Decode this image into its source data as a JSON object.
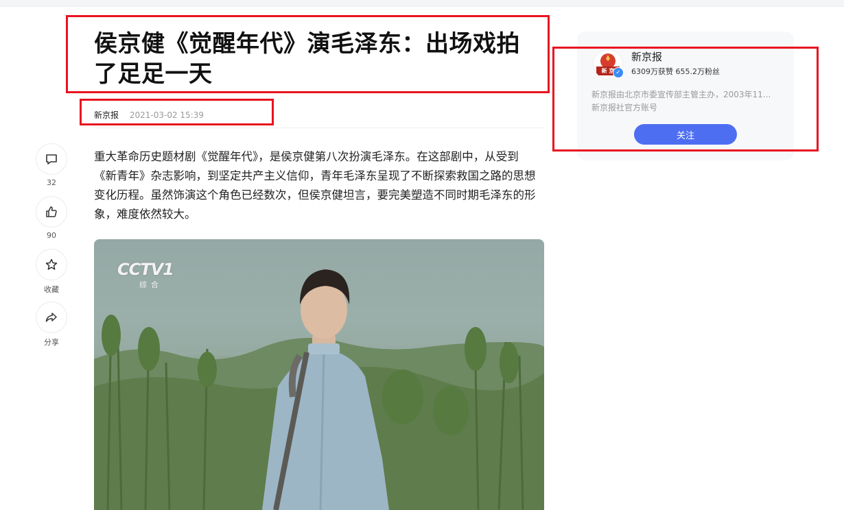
{
  "article": {
    "title": "侯京健《觉醒年代》演毛泽东：出场戏拍了足足一天",
    "source": "新京报",
    "date": "2021-03-02 15:39",
    "body": "重大革命历史题材剧《觉醒年代》，是侯京健第八次扮演毛泽东。在这部剧中，从受到《新青年》杂志影响，到坚定共产主义信仰，青年毛泽东呈现了不断探索救国之路的思想变化历程。虽然饰演这个角色已经数次，但侯京健坦言，要完美塑造不同时期毛泽东的形象，难度依然较大。"
  },
  "actions": [
    {
      "icon": "comment-icon",
      "label": "32"
    },
    {
      "icon": "thumbs-up-icon",
      "label": "90"
    },
    {
      "icon": "star-icon",
      "label": "收藏"
    },
    {
      "icon": "share-icon",
      "label": "分享"
    }
  ],
  "image": {
    "watermark": "CCTV1",
    "watermark_sub": "综合"
  },
  "author_card": {
    "name": "新京报",
    "stats": "6309万获赞 655.2万粉丝",
    "desc_line1": "新京报由北京市委宣传部主管主办，2003年11...",
    "desc_line2": "新京报社官方账号",
    "follow_label": "关注",
    "avatar_text": "新 京"
  },
  "colors": {
    "annotation": "#e8121f",
    "follow_button": "#4e6ef2",
    "verified_badge": "#3b8cf5"
  }
}
